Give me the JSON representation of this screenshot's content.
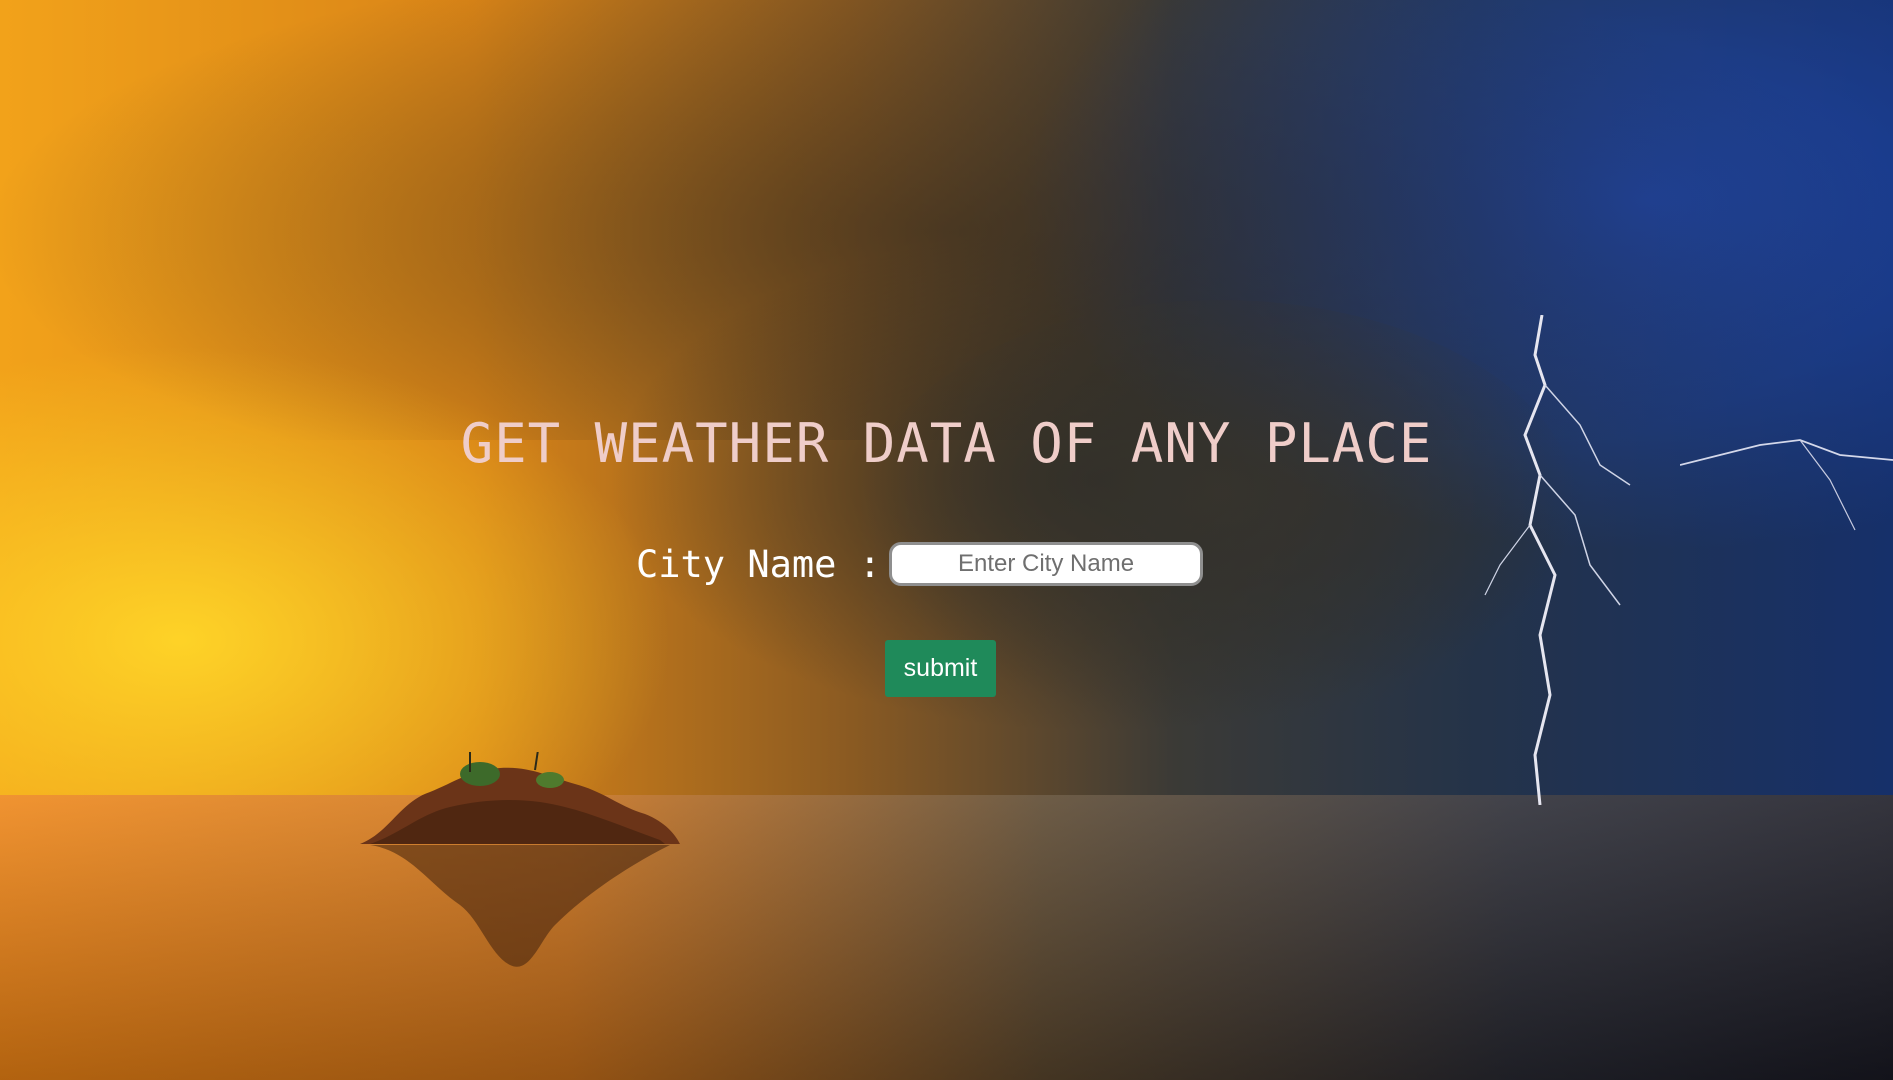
{
  "page": {
    "title": "GET WEATHER DATA OF ANY PLACE"
  },
  "form": {
    "city_label": "City Name :",
    "city_input": {
      "value": "",
      "placeholder": "Enter City Name"
    },
    "submit_label": "submit"
  },
  "colors": {
    "title_text": "#efcdc9",
    "label_text": "#ffffff",
    "submit_background": "#1f8a5a",
    "submit_text": "#ffffff"
  },
  "background": {
    "image": "stormy sunset over sea with island and lightning"
  }
}
